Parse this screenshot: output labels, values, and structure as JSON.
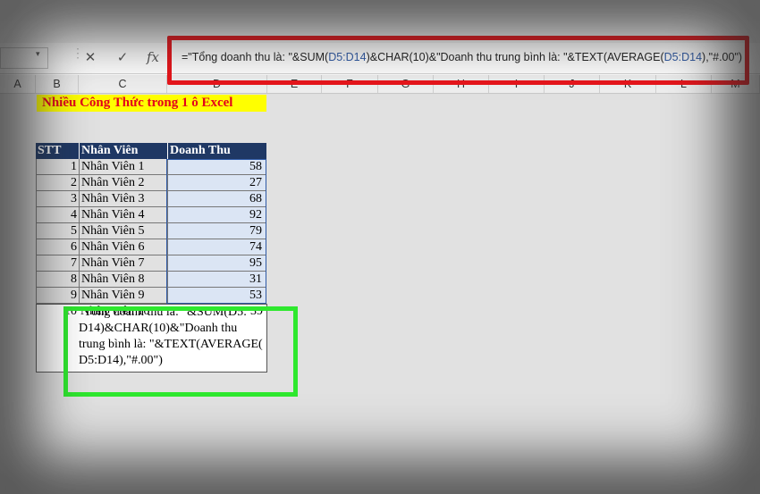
{
  "formula_bar": {
    "name_box_arrow": "▾",
    "cancel": "✕",
    "enter": "✓",
    "fx": "fx",
    "formula_parts": [
      {
        "text": "=\"Tổng doanh thu là: \"&SUM(",
        "ref": false
      },
      {
        "text": "D5:D14",
        "ref": true
      },
      {
        "text": ")&CHAR(10)&\"Doanh thu trung bình là: \"&TEXT(AVERAGE(",
        "ref": false
      },
      {
        "text": "D5:D14",
        "ref": true
      },
      {
        "text": "),\"#.00\")",
        "ref": false
      }
    ]
  },
  "columns": [
    "A",
    "B",
    "C",
    "D",
    "E",
    "F",
    "G",
    "H",
    "I",
    "J",
    "K",
    "L",
    "M"
  ],
  "sheet": {
    "title": "Nhiều Công Thức trong 1 ô Excel",
    "headers": {
      "stt": "STT",
      "name": "Nhân Viên",
      "revenue": "Doanh Thu"
    },
    "rows": [
      {
        "stt": "1",
        "name": "Nhân Viên 1",
        "revenue": "58"
      },
      {
        "stt": "2",
        "name": "Nhân Viên 2",
        "revenue": "27"
      },
      {
        "stt": "3",
        "name": "Nhân Viên 3",
        "revenue": "68"
      },
      {
        "stt": "4",
        "name": "Nhân Viên 4",
        "revenue": "92"
      },
      {
        "stt": "5",
        "name": "Nhân Viên 5",
        "revenue": "79"
      },
      {
        "stt": "6",
        "name": "Nhân Viên 6",
        "revenue": "74"
      },
      {
        "stt": "7",
        "name": "Nhân Viên 7",
        "revenue": "95"
      },
      {
        "stt": "8",
        "name": "Nhân Viên 8",
        "revenue": "31"
      },
      {
        "stt": "9",
        "name": "Nhân Viên 9",
        "revenue": "53"
      }
    ],
    "last_row": {
      "stt": "10",
      "name": "Nhân Viên 10",
      "revenue": "39"
    },
    "edit_lines": [
      "\"Tổng doanh thu là: \"&SUM(D5:",
      "D14)&CHAR(10)&\"Doanh thu",
      "trung bình là: \"&TEXT(AVERAGE(",
      "D5:D14),\"#.00\")"
    ]
  },
  "colors": {
    "highlight_red": "#e8151b",
    "highlight_green": "#2ee82e",
    "header_navy": "#1f3864",
    "title_yellow": "#ffff00",
    "title_red": "#e3001b",
    "selection_fill": "#dbe5f4"
  }
}
